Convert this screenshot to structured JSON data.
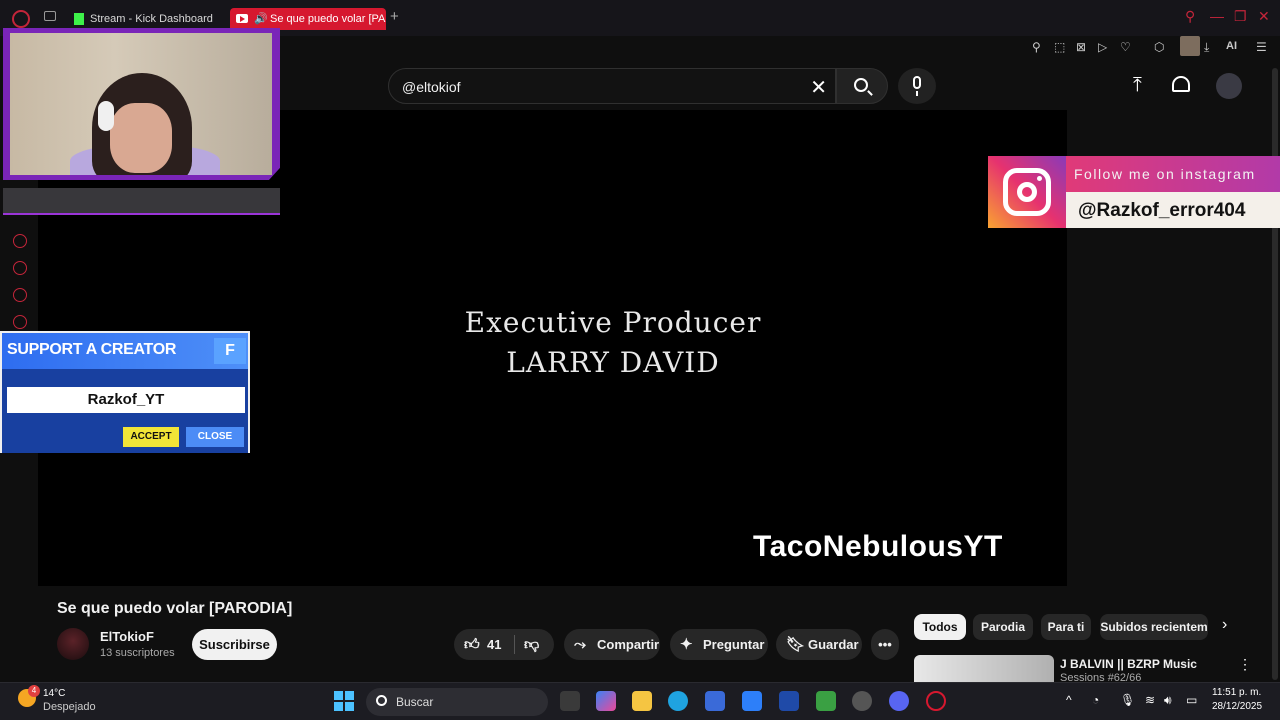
{
  "browser": {
    "tabs": [
      {
        "label": "Stream - Kick Dashboard",
        "active": false
      },
      {
        "label": "Se que puedo volar [PA",
        "active": true
      }
    ],
    "new_tab_label": "+",
    "ai_label": "AI"
  },
  "youtube": {
    "search": {
      "value": "@eltokiof",
      "placeholder": "Buscar"
    },
    "video": {
      "credit_line1": "Executive Producer",
      "credit_line2": "LARRY DAVID",
      "watermark": "TacoNebulousYT"
    },
    "title": "Se que puedo volar [PARODIA]",
    "channel": {
      "name": "ElTokioF",
      "subscribers": "13 suscriptores"
    },
    "subscribe_label": "Suscribirse",
    "actions": {
      "likes": "41",
      "share": "Compartir",
      "ask": "Preguntar",
      "save": "Guardar"
    },
    "chips": [
      "Todos",
      "Parodia",
      "Para ti",
      "Subidos recientem"
    ],
    "related": [
      {
        "title": "J BALVIN || BZRP Music",
        "subtitle": "Sessions #62/66"
      }
    ]
  },
  "overlays": {
    "instagram": {
      "follow_text": "Follow me on instagram",
      "handle": "@Razkof_error404"
    },
    "support_creator": {
      "title": "SUPPORT A CREATOR",
      "badge": "F",
      "code": "Razkof_YT",
      "accept": "ACCEPT",
      "close": "CLOSE"
    }
  },
  "taskbar": {
    "weather": {
      "temp": "14°C",
      "desc": "Despejado",
      "badge": "4"
    },
    "search_label": "Buscar",
    "clock": {
      "time": "11:51 p. m.",
      "date": "28/12/2025"
    }
  },
  "colors": {
    "accent_red": "#d6182f",
    "cam_purple": "#7a25b8",
    "fortnite_blue": "#2e6df0",
    "accept_yellow": "#f2e537"
  }
}
